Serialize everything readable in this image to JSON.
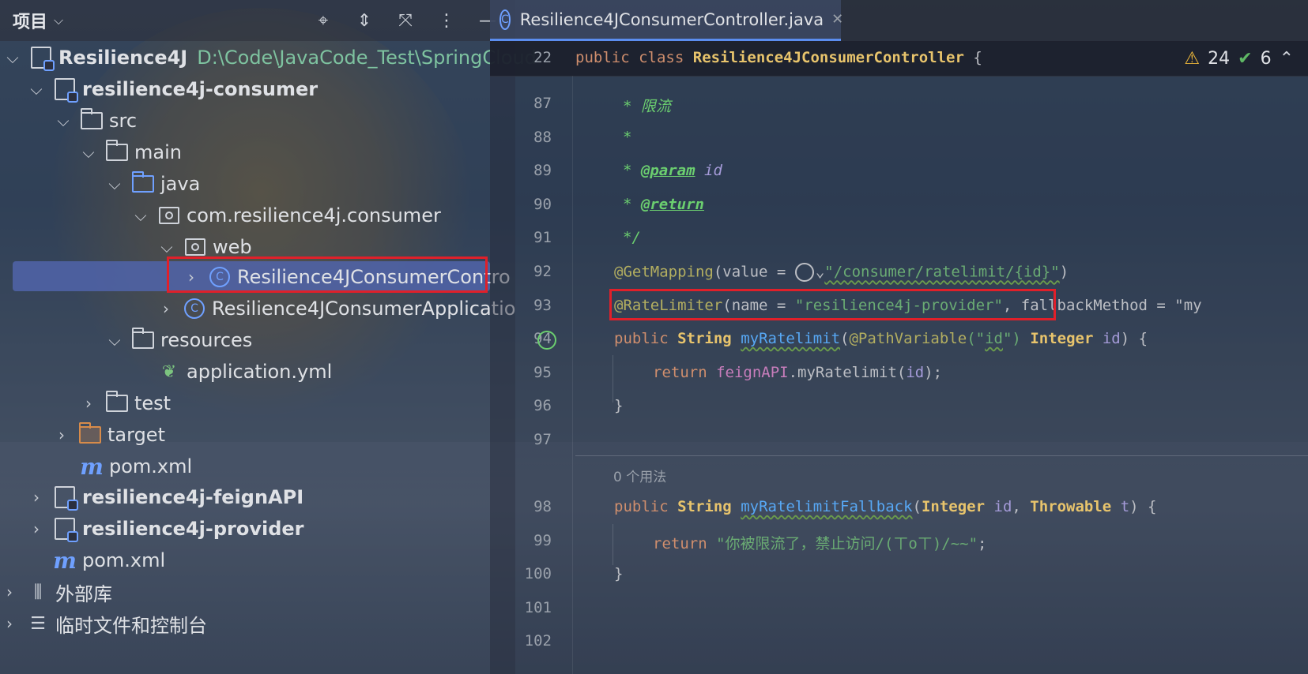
{
  "project_panel": {
    "title": "项目",
    "tree": [
      {
        "label": "Resilience4J",
        "path": "D:\\Code\\JavaCode_Test\\SpringCloud",
        "bold": true
      },
      {
        "label": "resilience4j-consumer",
        "bold": true
      },
      {
        "label": "src"
      },
      {
        "label": "main"
      },
      {
        "label": "java"
      },
      {
        "label": "com.resilience4j.consumer"
      },
      {
        "label": "web"
      },
      {
        "label": "Resilience4JConsumerContro"
      },
      {
        "label": "Resilience4JConsumerApplicatio"
      },
      {
        "label": "resources"
      },
      {
        "label": "application.yml"
      },
      {
        "label": "test"
      },
      {
        "label": "target"
      },
      {
        "label": "pom.xml"
      },
      {
        "label": "resilience4j-feignAPI",
        "bold": true
      },
      {
        "label": "resilience4j-provider",
        "bold": true
      },
      {
        "label": "pom.xml"
      },
      {
        "label": "外部库"
      },
      {
        "label": "临时文件和控制台"
      }
    ]
  },
  "editor": {
    "tab_label": "Resilience4JConsumerController.java",
    "sticky": {
      "line": "22",
      "text_kw1": "public",
      "text_kw2": "class",
      "class_name": "Resilience4JConsumerController",
      "brace": "{"
    },
    "inspections": {
      "warnings": "24",
      "ok": "6"
    },
    "line_numbers": [
      "87",
      "88",
      "89",
      "90",
      "91",
      "92",
      "93",
      "94",
      "95",
      "96",
      "97",
      "98",
      "99",
      "100",
      "101",
      "102"
    ],
    "usage_hint": "0 个用法",
    "code": {
      "l87_star": "*",
      "l87_text": "限流",
      "l88": "*",
      "l89_star": "*",
      "l89_tag": "@param",
      "l89_id": "id",
      "l90_star": "*",
      "l90_tag": "@return",
      "l91": "*/",
      "l92_ann": "@GetMapping",
      "l92_open": "(",
      "l92_attr": "value = ",
      "l92_str": "\"/consumer/ratelimit/{id}\"",
      "l92_close": ")",
      "l93_ann": "@RateLimiter",
      "l93_open": "(",
      "l93_attr": "name = ",
      "l93_str": "\"resilience4j-provider\"",
      "l93_rest": ", fallbackMethod = \"my",
      "l94_kw": "public",
      "l94_type": "String",
      "l94_fn": "myRatelimit",
      "l94_open": "(",
      "l94_ann": "@PathVariable",
      "l94_p1": "(\"",
      "l94_pstr": "id",
      "l94_p2": "\")",
      "l94_type2": "Integer",
      "l94_param": "id",
      "l94_close": ") {",
      "l95_kw": "return",
      "l95_fld": "feignAPI",
      "l95_call": ".myRatelimit(",
      "l95_param": "id",
      "l95_end": ");",
      "l96": "}",
      "l98_kw": "public",
      "l98_type": "String",
      "l98_fn": "myRatelimitFallback",
      "l98_open": "(",
      "l98_type2": "Integer",
      "l98_p1": "id",
      "l98_comma": ", ",
      "l98_type3": "Throwable",
      "l98_p2": "t",
      "l98_close": ") {",
      "l99_kw": "return",
      "l99_str": "\"你被限流了，禁止访问/(ㄒoㄒ)/~~\"",
      "l99_end": ";",
      "l100": "}"
    }
  },
  "colors": {
    "selection": "#5064aa",
    "highlight_box": "#e0202a",
    "accent": "#5b8def"
  }
}
